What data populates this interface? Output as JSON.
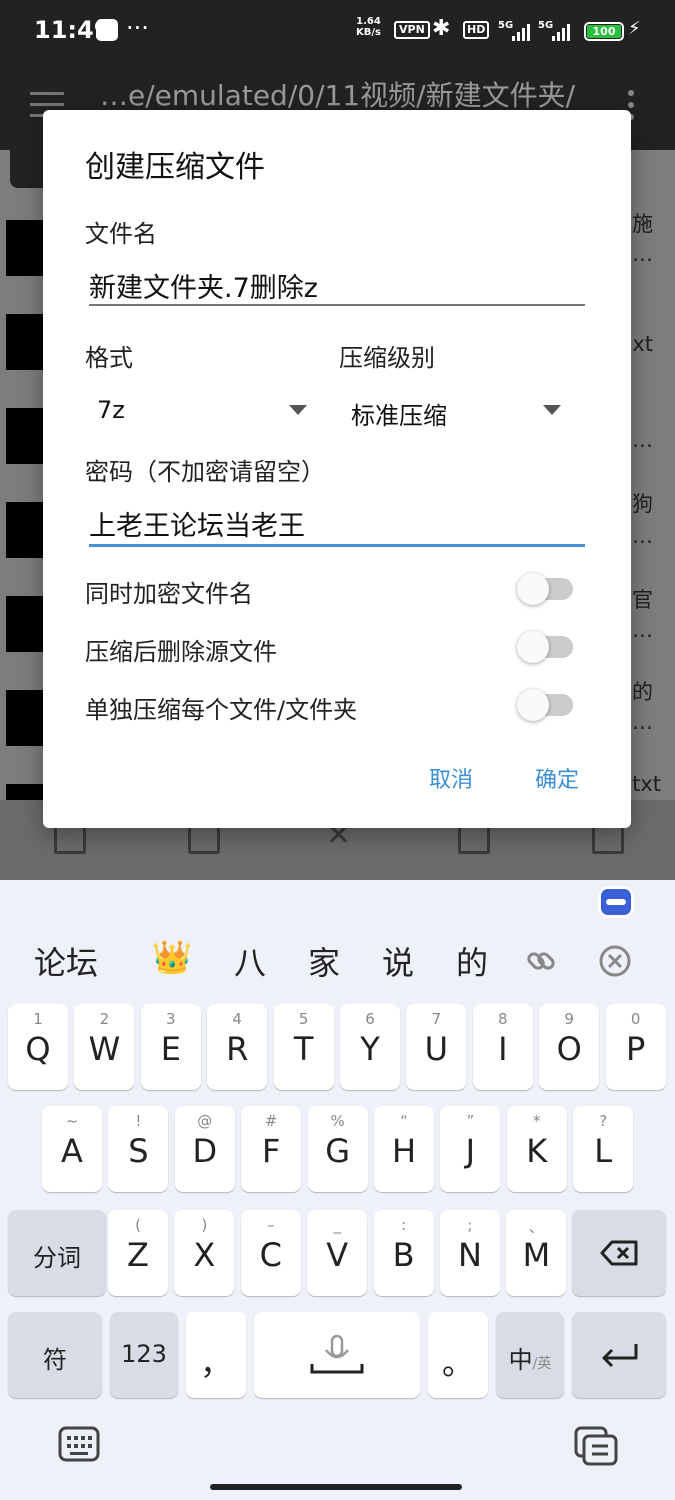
{
  "status_bar": {
    "time": "11:49",
    "dots": "···",
    "net_speed_value": "1.64",
    "net_speed_unit": "KB/s",
    "vpn": "VPN",
    "hd": "HD",
    "sig1": "5G",
    "sig2": "5G",
    "battery": "100",
    "bolt": "⚡"
  },
  "app_bar": {
    "path": "…e/emulated/0/11视频/新建文件夹/"
  },
  "background_fragments": [
    "施",
    "…",
    "xt",
    "…",
    "狗",
    "…",
    "官",
    "…",
    "的",
    "…",
    ".txt"
  ],
  "dialog": {
    "title": "创建压缩文件",
    "filename_label": "文件名",
    "filename_value": "新建文件夹.7删除z",
    "format_label": "格式",
    "format_value": "7z",
    "level_label": "压缩级别",
    "level_value": "标准压缩",
    "password_label": "密码（不加密请留空）",
    "password_value": "上老王论坛当老王",
    "switches": [
      {
        "label": "同时加密文件名",
        "on": false
      },
      {
        "label": "压缩后删除源文件",
        "on": false
      },
      {
        "label": "单独压缩每个文件/文件夹",
        "on": false
      }
    ],
    "cancel": "取消",
    "confirm": "确定"
  },
  "keyboard": {
    "candidates": [
      "论坛",
      "👑",
      "八",
      "家",
      "说",
      "的"
    ],
    "row1": [
      {
        "hint": "1",
        "key": "Q"
      },
      {
        "hint": "2",
        "key": "W"
      },
      {
        "hint": "3",
        "key": "E"
      },
      {
        "hint": "4",
        "key": "R"
      },
      {
        "hint": "5",
        "key": "T"
      },
      {
        "hint": "6",
        "key": "Y"
      },
      {
        "hint": "7",
        "key": "U"
      },
      {
        "hint": "8",
        "key": "I"
      },
      {
        "hint": "9",
        "key": "O"
      },
      {
        "hint": "0",
        "key": "P"
      }
    ],
    "row2": [
      {
        "hint": "~",
        "key": "A"
      },
      {
        "hint": "!",
        "key": "S"
      },
      {
        "hint": "@",
        "key": "D"
      },
      {
        "hint": "#",
        "key": "F"
      },
      {
        "hint": "%",
        "key": "G"
      },
      {
        "hint": "“",
        "key": "H"
      },
      {
        "hint": "”",
        "key": "J"
      },
      {
        "hint": "*",
        "key": "K"
      },
      {
        "hint": "?",
        "key": "L"
      }
    ],
    "row3": [
      {
        "hint": "(",
        "key": "Z"
      },
      {
        "hint": ")",
        "key": "X"
      },
      {
        "hint": "–",
        "key": "C"
      },
      {
        "hint": "_",
        "key": "V"
      },
      {
        "hint": ":",
        "key": "B"
      },
      {
        "hint": ";",
        "key": "N"
      },
      {
        "hint": "、",
        "key": "M"
      }
    ],
    "segment_key": "分词",
    "symbol_key": "符",
    "num_key": "123",
    "comma_key": "，",
    "period_key": "。",
    "lang_key_main": "中",
    "lang_key_sub": "/英"
  }
}
